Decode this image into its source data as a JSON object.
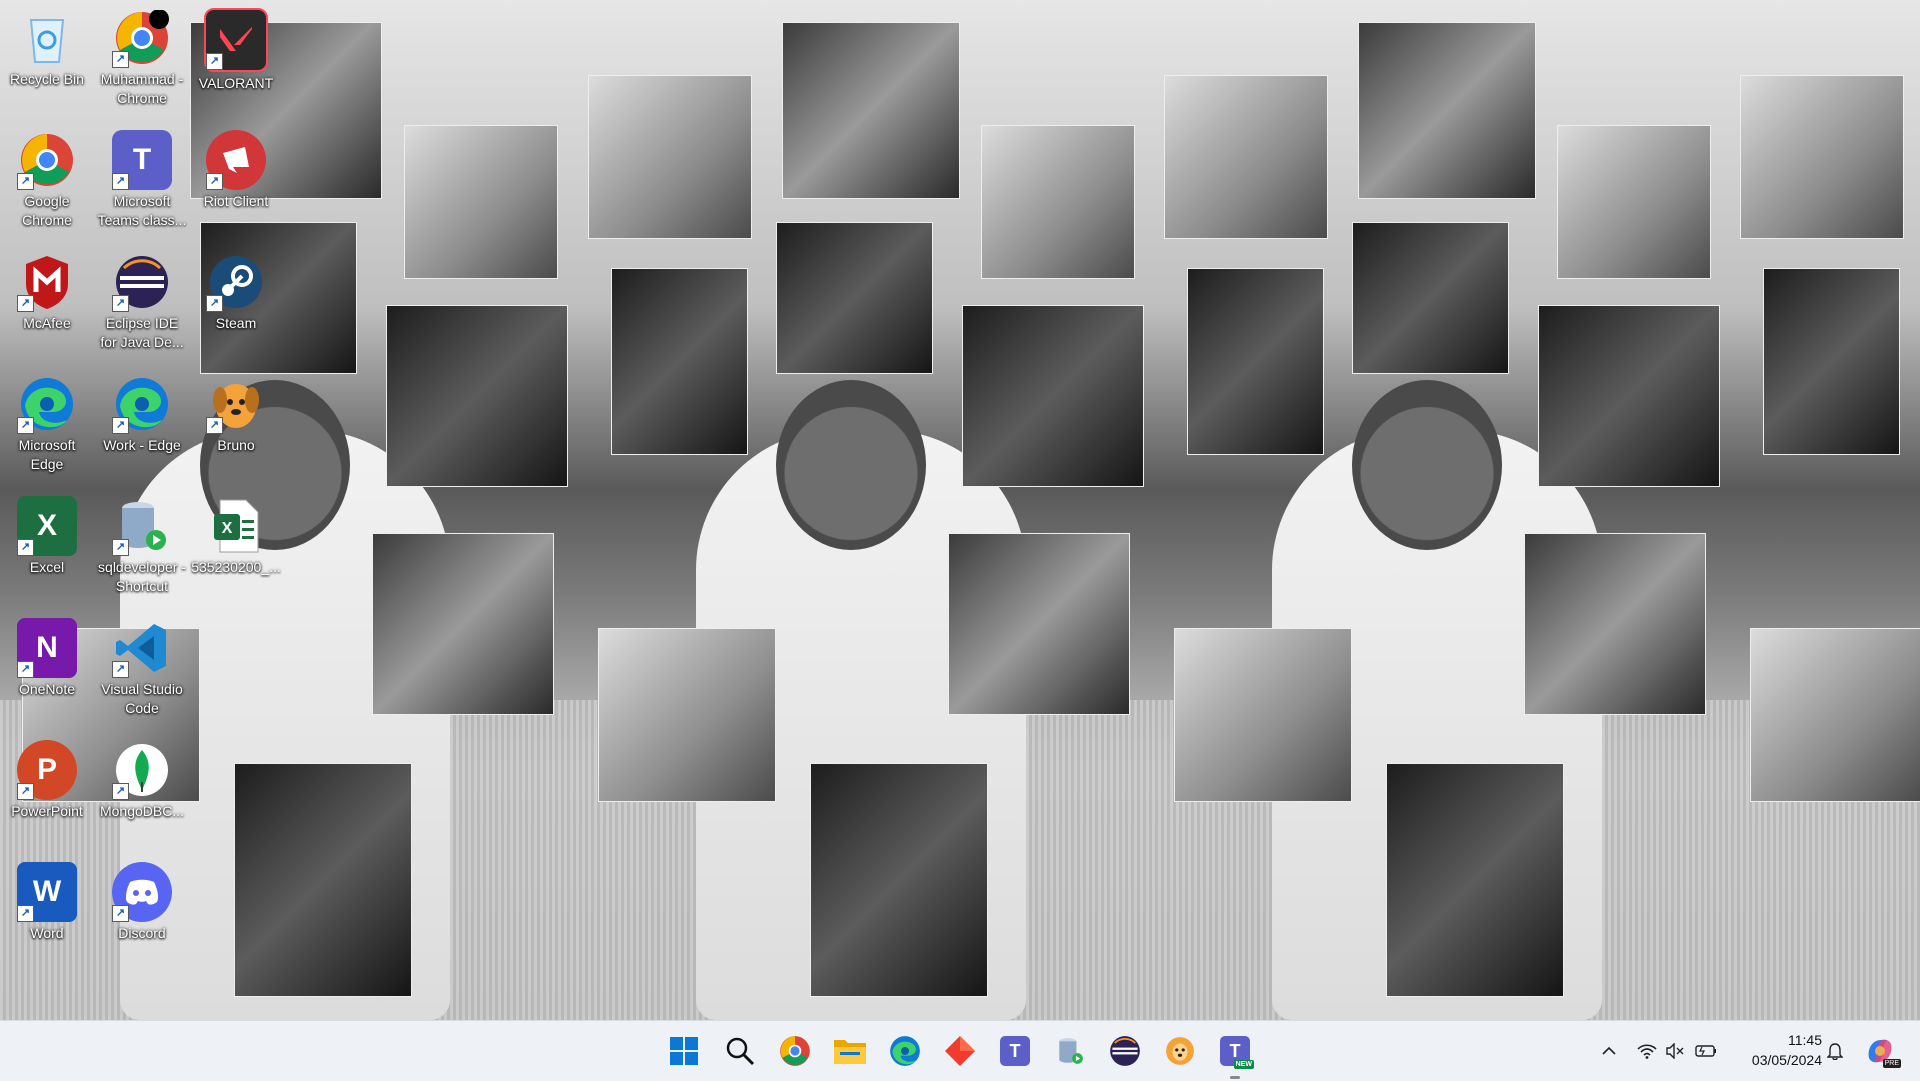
{
  "desktop_icons": [
    {
      "label": "Recycle Bin",
      "icon": "recycle-bin-icon",
      "color": "#7fb7e8"
    },
    {
      "label": "Muhammad - Chrome",
      "icon": "chrome-icon",
      "color": "#4285f4"
    },
    {
      "label": "VALORANT",
      "icon": "valorant-icon",
      "color": "#ff4655"
    },
    {
      "label": "Google Chrome",
      "icon": "chrome-icon",
      "color": "#4285f4"
    },
    {
      "label": "Microsoft Teams class...",
      "icon": "teams-icon",
      "color": "#5b5fc7"
    },
    {
      "label": "Riot Client",
      "icon": "riot-client-icon",
      "color": "#d13639"
    },
    {
      "label": "McAfee",
      "icon": "mcafee-icon",
      "color": "#c01818"
    },
    {
      "label": "Eclipse IDE for Java De...",
      "icon": "eclipse-icon",
      "color": "#2c2255"
    },
    {
      "label": "Steam",
      "icon": "steam-icon",
      "color": "#1b4b78"
    },
    {
      "label": "Microsoft Edge",
      "icon": "edge-icon",
      "color": "#0f7ad8"
    },
    {
      "label": "Work - Edge",
      "icon": "edge-icon",
      "color": "#0f7ad8"
    },
    {
      "label": "Bruno",
      "icon": "bruno-icon",
      "color": "#f4a23a"
    },
    {
      "label": "Excel",
      "icon": "excel-icon",
      "color": "#1d6f42"
    },
    {
      "label": "sqldeveloper - Shortcut",
      "icon": "sqldeveloper-icon",
      "color": "#8fa9c9"
    },
    {
      "label": "535230200_...",
      "icon": "excel-file-icon",
      "color": "#1d6f42"
    },
    {
      "label": "OneNote",
      "icon": "onenote-icon",
      "color": "#7719aa"
    },
    {
      "label": "Visual Studio Code",
      "icon": "vscode-icon",
      "color": "#1f8ad2"
    },
    {
      "label": "PowerPoint",
      "icon": "powerpoint-icon",
      "color": "#d24726"
    },
    {
      "label": "MongoDBC...",
      "icon": "mongodb-compass-icon",
      "color": "#13aa52"
    },
    {
      "label": "Word",
      "icon": "word-icon",
      "color": "#185abd"
    },
    {
      "label": "Discord",
      "icon": "discord-icon",
      "color": "#5865f2"
    }
  ],
  "taskbar": {
    "apps": [
      {
        "name": "start-button",
        "icon": "windows-start-icon"
      },
      {
        "name": "search-button",
        "icon": "search-icon"
      },
      {
        "name": "chrome",
        "icon": "chrome-icon"
      },
      {
        "name": "file-explorer",
        "icon": "folder-icon"
      },
      {
        "name": "edge",
        "icon": "edge-icon"
      },
      {
        "name": "app-red",
        "icon": "diamond-app-icon"
      },
      {
        "name": "teams-classic",
        "icon": "teams-icon"
      },
      {
        "name": "sqldeveloper",
        "icon": "sqldeveloper-icon"
      },
      {
        "name": "eclipse",
        "icon": "eclipse-icon"
      },
      {
        "name": "bruno",
        "icon": "bruno-icon"
      },
      {
        "name": "teams-new",
        "icon": "teams-new-icon",
        "badge": "NEW"
      }
    ],
    "tray": {
      "chevron": "show-hidden-icons",
      "wifi": "wifi-icon",
      "volume": "volume-muted-icon",
      "battery": "battery-icon",
      "time": "11:45",
      "date": "03/05/2024",
      "notifications": "bell-icon",
      "copilot": "copilot-icon",
      "copilot_badge": "PRE"
    }
  }
}
